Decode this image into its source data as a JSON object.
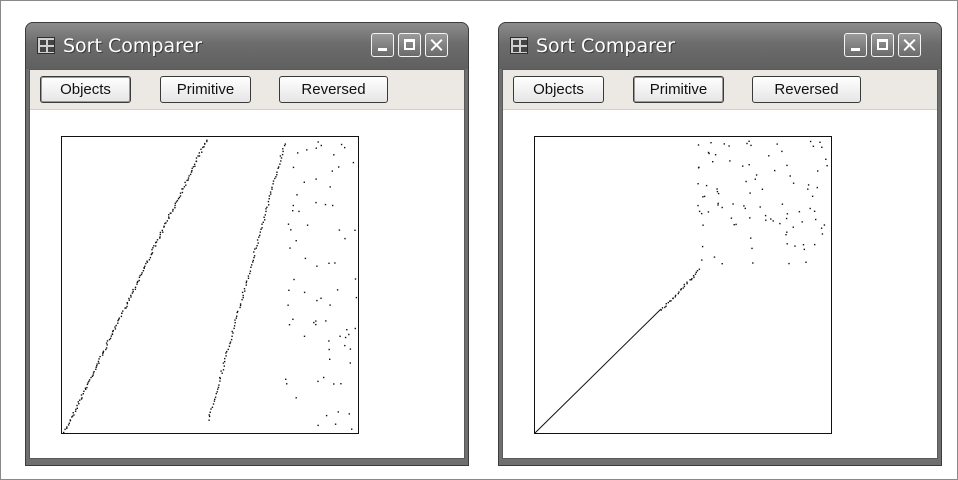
{
  "windows": [
    {
      "title": "Sort Comparer",
      "buttons": [
        "Objects",
        "Primitive",
        "Reversed"
      ],
      "focused_button": 0,
      "controls": [
        "minimize-icon",
        "maximize-icon",
        "close-icon"
      ]
    },
    {
      "title": "Sort Comparer",
      "buttons": [
        "Objects",
        "Primitive",
        "Reversed"
      ],
      "focused_button": 1,
      "controls": [
        "minimize-icon",
        "maximize-icon",
        "close-icon"
      ]
    }
  ]
}
